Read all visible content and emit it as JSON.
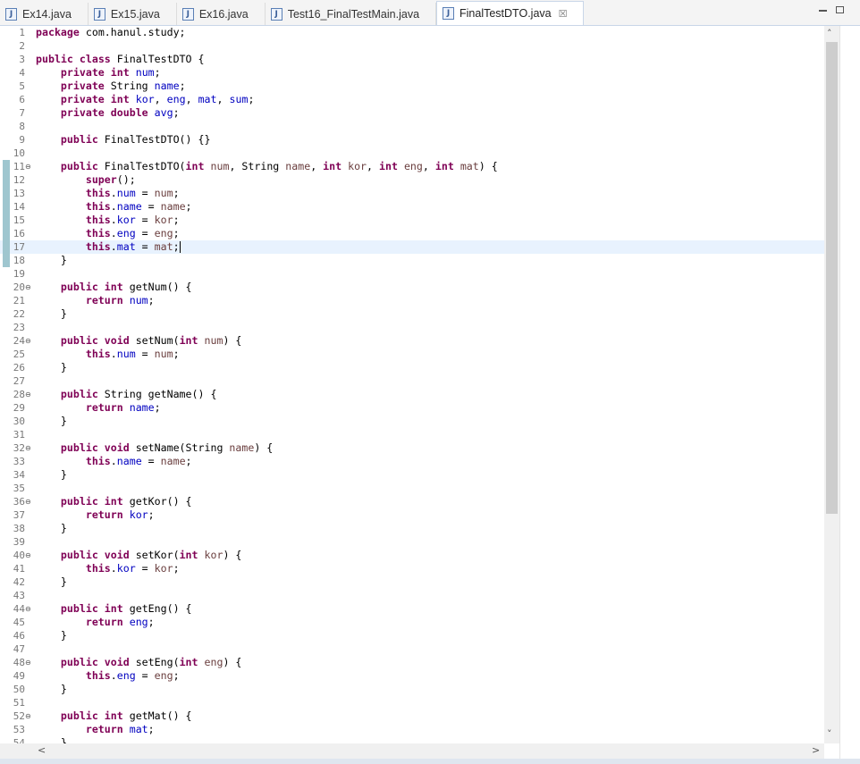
{
  "tabs": [
    {
      "label": "Ex14.java",
      "icon": "java-file-icon"
    },
    {
      "label": "Ex15.java",
      "icon": "java-file-icon"
    },
    {
      "label": "Ex16.java",
      "icon": "java-file-icon"
    },
    {
      "label": "Test16_FinalTestMain.java",
      "icon": "java-file-icon"
    },
    {
      "label": "FinalTestDTO.java",
      "icon": "java-file-icon",
      "active": true,
      "close": "☒"
    }
  ],
  "window": {
    "min": "",
    "max": ""
  },
  "editor": {
    "current_line": 17,
    "changed_lines": [
      11,
      18
    ],
    "lines": [
      {
        "n": "1",
        "code": "package com.hanul.study;"
      },
      {
        "n": "2",
        "code": ""
      },
      {
        "n": "3",
        "code": "public class FinalTestDTO {"
      },
      {
        "n": "4",
        "code": "    private int num;"
      },
      {
        "n": "5",
        "code": "    private String name;"
      },
      {
        "n": "6",
        "code": "    private int kor, eng, mat, sum;"
      },
      {
        "n": "7",
        "code": "    private double avg;"
      },
      {
        "n": "8",
        "code": ""
      },
      {
        "n": "9",
        "code": "    public FinalTestDTO() {}"
      },
      {
        "n": "10",
        "code": ""
      },
      {
        "n": "11",
        "code": "    public FinalTestDTO(int num, String name, int kor, int eng, int mat) {",
        "fold": true
      },
      {
        "n": "12",
        "code": "        super();"
      },
      {
        "n": "13",
        "code": "        this.num = num;"
      },
      {
        "n": "14",
        "code": "        this.name = name;"
      },
      {
        "n": "15",
        "code": "        this.kor = kor;"
      },
      {
        "n": "16",
        "code": "        this.eng = eng;"
      },
      {
        "n": "17",
        "code": "        this.mat = mat;"
      },
      {
        "n": "18",
        "code": "    }"
      },
      {
        "n": "19",
        "code": ""
      },
      {
        "n": "20",
        "code": "    public int getNum() {",
        "fold": true
      },
      {
        "n": "21",
        "code": "        return num;"
      },
      {
        "n": "22",
        "code": "    }"
      },
      {
        "n": "23",
        "code": ""
      },
      {
        "n": "24",
        "code": "    public void setNum(int num) {",
        "fold": true
      },
      {
        "n": "25",
        "code": "        this.num = num;"
      },
      {
        "n": "26",
        "code": "    }"
      },
      {
        "n": "27",
        "code": ""
      },
      {
        "n": "28",
        "code": "    public String getName() {",
        "fold": true
      },
      {
        "n": "29",
        "code": "        return name;"
      },
      {
        "n": "30",
        "code": "    }"
      },
      {
        "n": "31",
        "code": ""
      },
      {
        "n": "32",
        "code": "    public void setName(String name) {",
        "fold": true
      },
      {
        "n": "33",
        "code": "        this.name = name;"
      },
      {
        "n": "34",
        "code": "    }"
      },
      {
        "n": "35",
        "code": ""
      },
      {
        "n": "36",
        "code": "    public int getKor() {",
        "fold": true
      },
      {
        "n": "37",
        "code": "        return kor;"
      },
      {
        "n": "38",
        "code": "    }"
      },
      {
        "n": "39",
        "code": ""
      },
      {
        "n": "40",
        "code": "    public void setKor(int kor) {",
        "fold": true
      },
      {
        "n": "41",
        "code": "        this.kor = kor;"
      },
      {
        "n": "42",
        "code": "    }"
      },
      {
        "n": "43",
        "code": ""
      },
      {
        "n": "44",
        "code": "    public int getEng() {",
        "fold": true
      },
      {
        "n": "45",
        "code": "        return eng;"
      },
      {
        "n": "46",
        "code": "    }"
      },
      {
        "n": "47",
        "code": ""
      },
      {
        "n": "48",
        "code": "    public void setEng(int eng) {",
        "fold": true
      },
      {
        "n": "49",
        "code": "        this.eng = eng;"
      },
      {
        "n": "50",
        "code": "    }"
      },
      {
        "n": "51",
        "code": ""
      },
      {
        "n": "52",
        "code": "    public int getMat() {",
        "fold": true
      },
      {
        "n": "53",
        "code": "        return mat;"
      },
      {
        "n": "54",
        "code": "    }"
      }
    ]
  },
  "scrollbar": {
    "up": "˄",
    "down": "˅",
    "left": "<",
    "right": ">"
  },
  "colors": {
    "keyword": "#7f0055",
    "field": "#0000c0",
    "param": "#6a3e3e",
    "current_line": "#e8f2fe"
  }
}
